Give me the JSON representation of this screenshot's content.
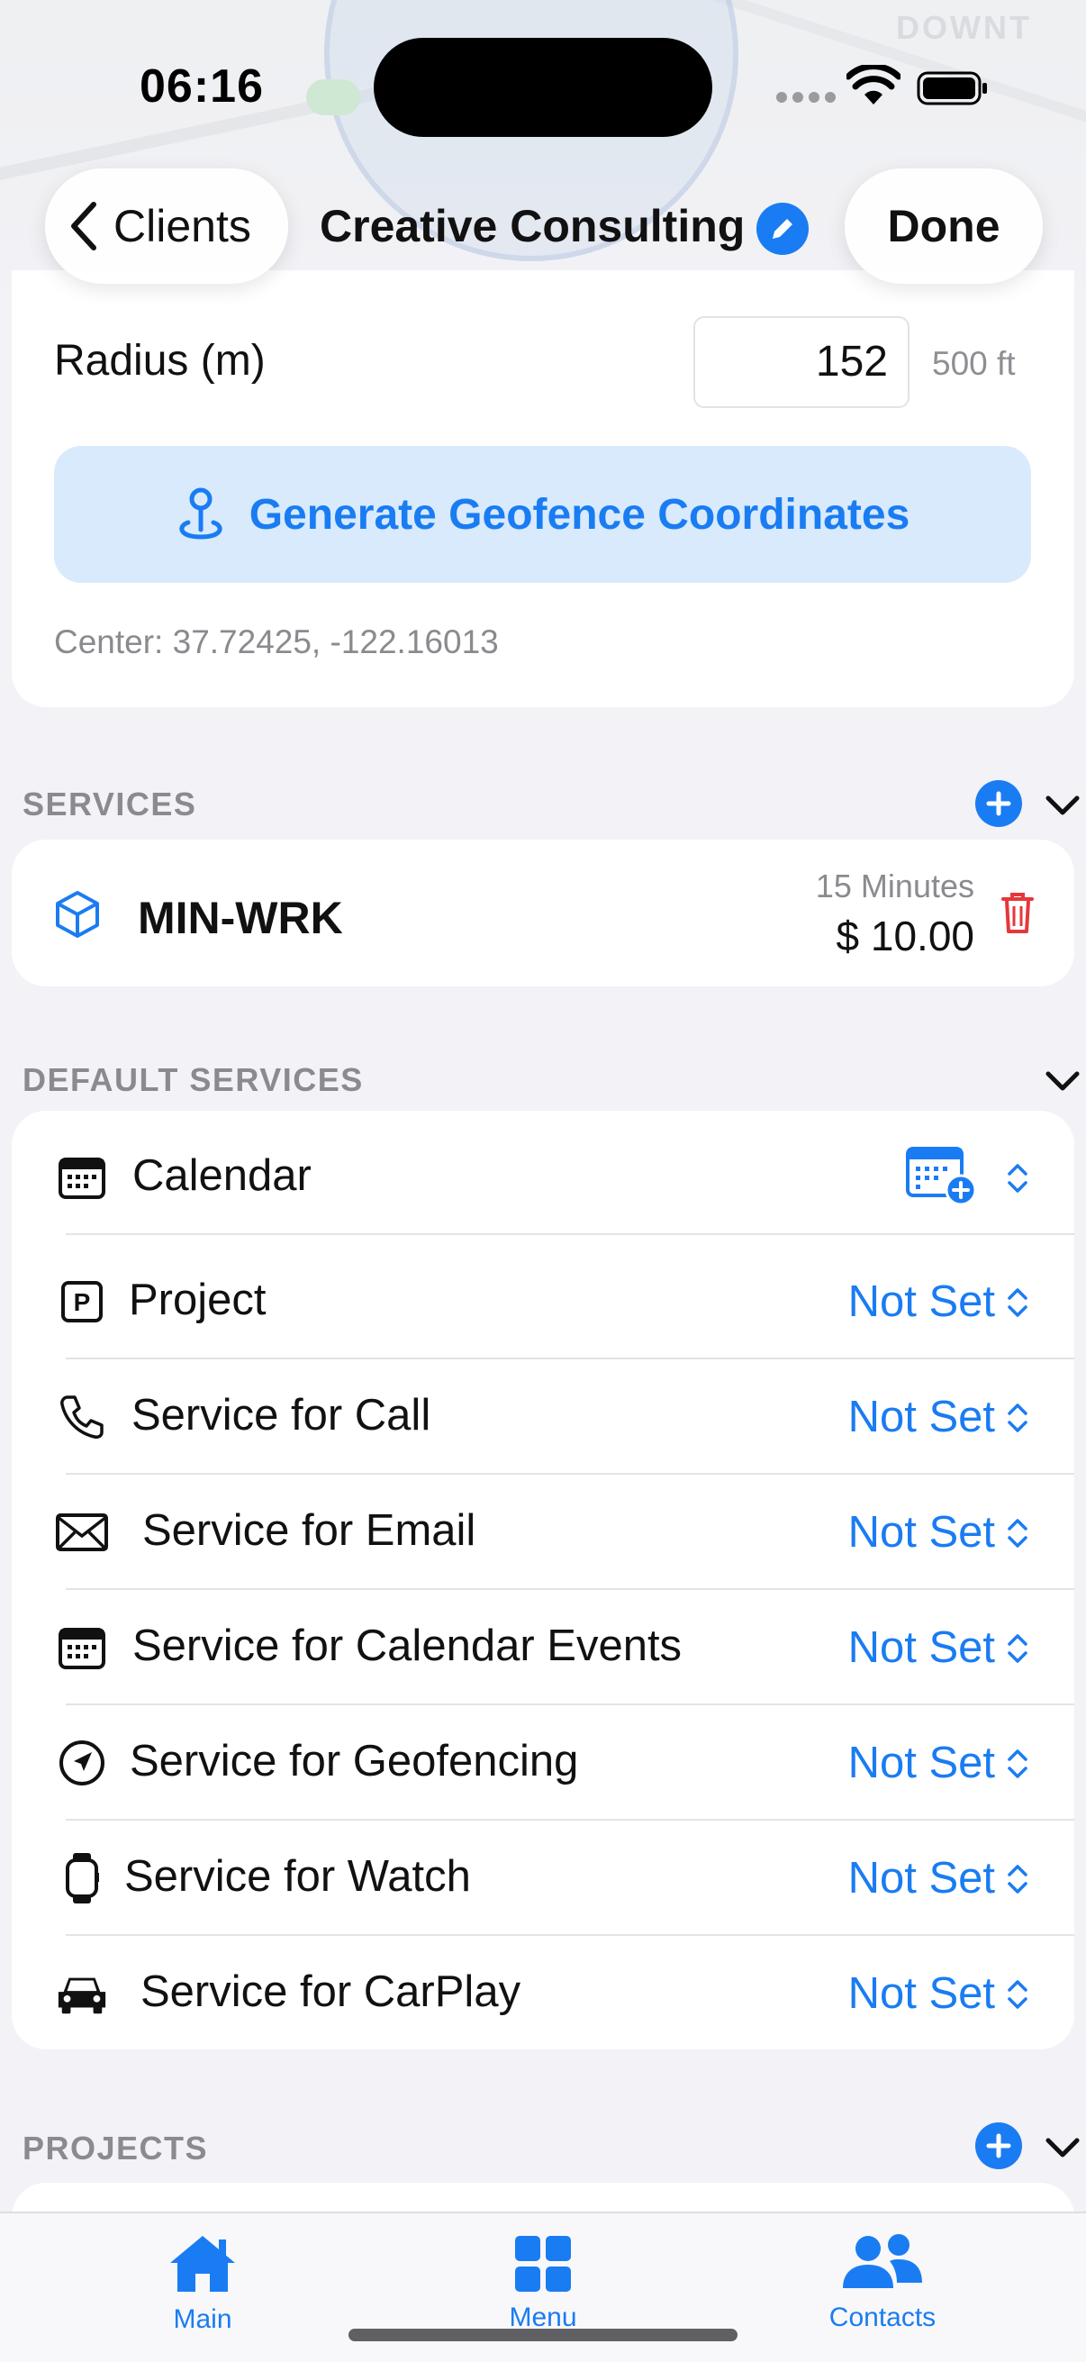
{
  "status_bar": {
    "time": "06:16"
  },
  "map": {
    "label": "DOWNT"
  },
  "nav": {
    "back_label": "Clients",
    "title": "Creative Consulting",
    "done_label": "Done"
  },
  "geofence": {
    "radius_label": "Radius (m)",
    "radius_value": "152",
    "radius_feet": "500 ft",
    "generate_label": "Generate Geofence Coordinates",
    "center_text": "Center: 37.72425, -122.16013"
  },
  "services": {
    "header": "SERVICES",
    "items": [
      {
        "name": "MIN-WRK",
        "duration": "15 Minutes",
        "price": "$ 10.00"
      }
    ]
  },
  "default_services": {
    "header": "DEFAULT SERVICES",
    "rows": [
      {
        "label": "Calendar",
        "icon": "calendar-icon",
        "value": ""
      },
      {
        "label": "Project",
        "icon": "project-p-icon",
        "value": "Not Set"
      },
      {
        "label": "Service for Call",
        "icon": "phone-icon",
        "value": "Not Set"
      },
      {
        "label": "Service for Email",
        "icon": "envelope-icon",
        "value": "Not Set"
      },
      {
        "label": "Service for Calendar Events",
        "icon": "calendar-icon",
        "value": "Not Set"
      },
      {
        "label": "Service for Geofencing",
        "icon": "location-arrow-icon",
        "value": "Not Set"
      },
      {
        "label": "Service for Watch",
        "icon": "watch-icon",
        "value": "Not Set"
      },
      {
        "label": "Service for CarPlay",
        "icon": "car-icon",
        "value": "Not Set"
      }
    ]
  },
  "projects": {
    "header": "PROJECTS"
  },
  "tabbar": {
    "tabs": [
      {
        "label": "Main",
        "icon": "house-icon"
      },
      {
        "label": "Menu",
        "icon": "grid-icon"
      },
      {
        "label": "Contacts",
        "icon": "people-icon"
      }
    ]
  },
  "colors": {
    "accent": "#1a7cf2",
    "background": "#f2f2f7",
    "delete": "#e5383b",
    "secondary_text": "#8a8a8f"
  }
}
